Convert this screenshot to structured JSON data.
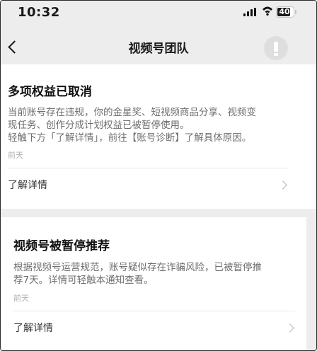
{
  "status_bar": {
    "time": "10:32",
    "battery_level": "40",
    "signal_icon": "cellular-signal-icon",
    "wifi_icon": "wifi-icon"
  },
  "nav": {
    "title": "视频号团队",
    "back_icon": "chevron-left-icon"
  },
  "messages": [
    {
      "title": "多项权益已取消",
      "body_line1": "当前账号存在违规，你的金星奖、短视频商品分享、视频变",
      "body_line2": "现任务、创作分成计划权益已被暂停使用。",
      "body_line3": "轻触下方「了解详情」，前往【账号诊断】了解具体原因。",
      "date": "前天",
      "link_label": "了解详情"
    },
    {
      "title": "视频号被暂停推荐",
      "body_line1": "根据视频号运营规范，账号疑似存在诈骗风险，已被暂停推",
      "body_line2": "荐7天。详情可轻触本通知查看。",
      "date": "前天",
      "link_label": "了解详情"
    }
  ],
  "colors": {
    "background": "#ededed",
    "card": "#ffffff",
    "title_text": "#111111",
    "body_text": "#6f6f6f",
    "date_text": "#b2b2b2"
  }
}
